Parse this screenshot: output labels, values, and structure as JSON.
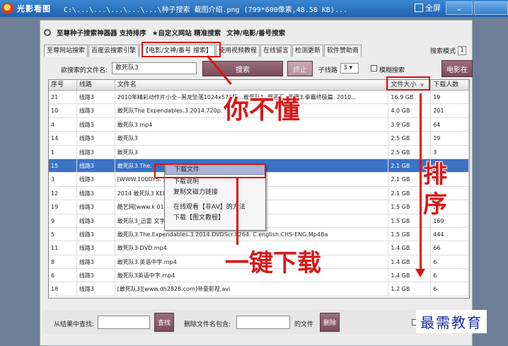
{
  "viewer": {
    "app_name": "光影看图",
    "file_title": "C:\\...\\...\\...\\...\\...\\种子搜索 截图介绍.png (799*600像素,48.58 KB)...",
    "fullscreen_label": "全屏",
    "collapse_glyph": "⌄"
  },
  "toolbar": {
    "items": [
      "至尊种子搜索神器器 支持排序",
      "★自定义网站 精准搜索",
      "文神/电影/番号搜索"
    ]
  },
  "tabs": [
    "至尊网站搜索",
    "百度云搜索引擎",
    "【电影/文神/番号 搜索】",
    "使用视频教程",
    "在线留言",
    "检测更新",
    "软件赞助商"
  ],
  "search_mode": {
    "label": "搜索模式",
    "value": "1"
  },
  "search": {
    "filename_label": "欲搜索的文件名:",
    "filename_value": "敢死队3",
    "search_button": "搜索",
    "stop_button": "终止",
    "thread_label": "子线路",
    "thread_value": "3",
    "fuzzy_label": "模糊搜索",
    "movie_button": "电影在"
  },
  "table": {
    "headers": [
      "序号",
      "线路",
      "文件名",
      "文件大小",
      "下载人数"
    ],
    "sort_indicator": "v",
    "rows": [
      [
        "21",
        "线路3",
        "2010年精彩动作片小全--黑龙坠落1024x576版...敢死队1, 罪恶汇, 拳霸3.拳霸终极篇. 2010...",
        "16.9 GB",
        "19"
      ],
      [
        "10",
        "线路3",
        "敢死队The Expendables.3.2014.720p.",
        "4.0 GB",
        "201"
      ],
      [
        "4",
        "线路3",
        "敢死队3.mp4",
        "3.9 GB",
        "64"
      ],
      [
        "14",
        "线路3",
        "敢死队3",
        "2.5 GB",
        "19"
      ],
      [
        "1",
        "线路3",
        "敢死队3",
        "2.5 GB",
        "3"
      ],
      [
        "15",
        "线路3",
        "敢死队3.The.",
        "2.1 GB",
        "2"
      ],
      [
        "3",
        "线路3",
        "[WWW.100DYS.",
        ") 720p DVDScr [G2G]-muxed.mkv",
        "2.1 GB",
        "6"
      ],
      [
        "12",
        "线路3",
        "2014 敢死队3",
        "KED.CLEAN.XviD-XWCTY.2.05GB",
        "2.1 GB",
        "6"
      ],
      [
        "19",
        "线路3",
        "酷艺网[www.k",
        "014.HD480p.x264.AAC 英语中字",
        "1.5 GB",
        "2"
      ],
      [
        "9",
        "线路3",
        "敢死队3_迅雷",
        "文字幕.torrent.wmv",
        "1.5 GB",
        "169"
      ],
      [
        "5",
        "线路3",
        "敢死队3.The.Expendables.3.2014.DVDScr.X264.",
        "C.english.CHS-ENG.Mp4Ba",
        "1.5 GB",
        "444"
      ],
      [
        "11",
        "线路3",
        "敢死队3-DVD.mp4",
        "1.4 GB",
        "66"
      ],
      [
        "8",
        "线路3",
        "敢死队3.英语中字.mp4",
        "1.4 GB",
        "6"
      ],
      [
        "6",
        "线路3",
        "敢死队3英语中字.mp4",
        "1.4 GB",
        "6"
      ],
      [
        "18",
        "线路3",
        "[敢死队3][www.dh2828.com]帝豪影视.avi",
        "1.2 GB",
        "6"
      ]
    ]
  },
  "context_menu": {
    "items": [
      "下载文件",
      "下载说明",
      "复制文磁力链接",
      "在线观看【非AV】的方法",
      "下载【图文教程】"
    ]
  },
  "filter": {
    "find_label": "从结果中查找:",
    "find_button": "查找",
    "delete_label": "删除文件名包含:",
    "suffix_label": "的文件",
    "delete_button": "删除"
  },
  "annotations": {
    "dont_understand": "你不懂",
    "sort": "排序",
    "one_click": "一键下载"
  },
  "watermark": "最需教育",
  "colors": {
    "accent": "#e01010",
    "selected_row": "#3b72c4",
    "title_bar": "#2a72bd"
  }
}
